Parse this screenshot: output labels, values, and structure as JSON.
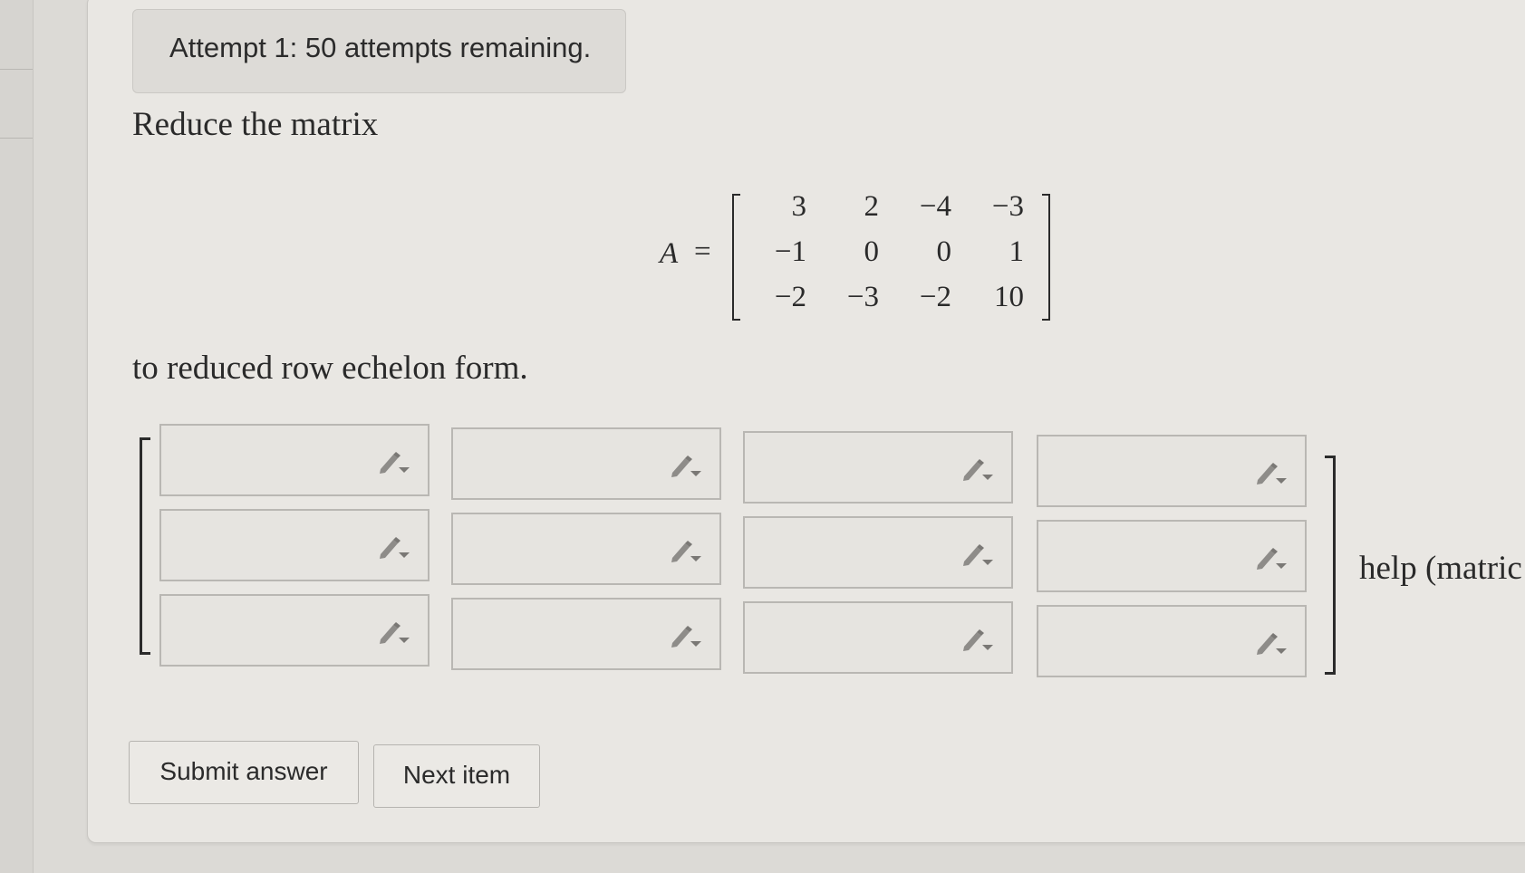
{
  "attempts_notice": "Attempt 1: 50 attempts remaining.",
  "problem": {
    "lead": "Reduce the matrix",
    "matrix_label": "A",
    "equals": "=",
    "rows": [
      [
        "3",
        "2",
        "−4",
        "−3"
      ],
      [
        "−1",
        "0",
        "0",
        "1"
      ],
      [
        "−2",
        "−3",
        "−2",
        "10"
      ]
    ],
    "tail": "to reduced row echelon form."
  },
  "answer": {
    "rows": 3,
    "cols": 4,
    "values": [
      [
        "",
        "",
        "",
        ""
      ],
      [
        "",
        "",
        "",
        ""
      ],
      [
        "",
        "",
        "",
        ""
      ]
    ],
    "help_text": "help (matric"
  },
  "buttons": {
    "submit_label": "Submit answer",
    "next_label": "Next item"
  },
  "icons": {
    "entry_tool": "pencil-dropdown-icon"
  }
}
